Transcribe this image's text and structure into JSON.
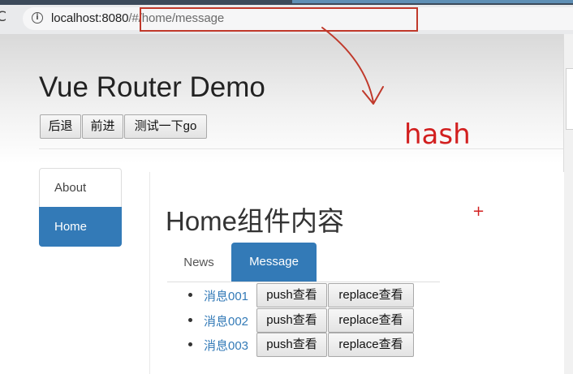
{
  "browser": {
    "url_host": "localhost:8080",
    "url_rest": "/#/home/message",
    "reload_icon": "reload-icon",
    "info_icon": "info-icon",
    "info_glyph": "i",
    "reload_glyph": "C"
  },
  "page": {
    "title": "Vue Router Demo",
    "history_buttons": {
      "back": "后退",
      "forward": "前进",
      "go": "测试一下go"
    }
  },
  "nav": {
    "items": [
      {
        "label": "About",
        "active": false
      },
      {
        "label": "Home",
        "active": true
      }
    ]
  },
  "home": {
    "heading": "Home组件内容",
    "tabs": [
      {
        "label": "News",
        "active": false
      },
      {
        "label": "Message",
        "active": true
      }
    ],
    "messages": [
      {
        "link": "消息001",
        "push_label": "push查看",
        "replace_label": "replace查看"
      },
      {
        "link": "消息002",
        "push_label": "push查看",
        "replace_label": "replace查看"
      },
      {
        "link": "消息003",
        "push_label": "push查看",
        "replace_label": "replace查看"
      }
    ]
  },
  "annotations": {
    "hash_label": "hash",
    "plus_mark": "+",
    "color": "#d21f1f"
  },
  "colors": {
    "accent": "#337ab7",
    "annotation_red": "#d21f1f"
  }
}
